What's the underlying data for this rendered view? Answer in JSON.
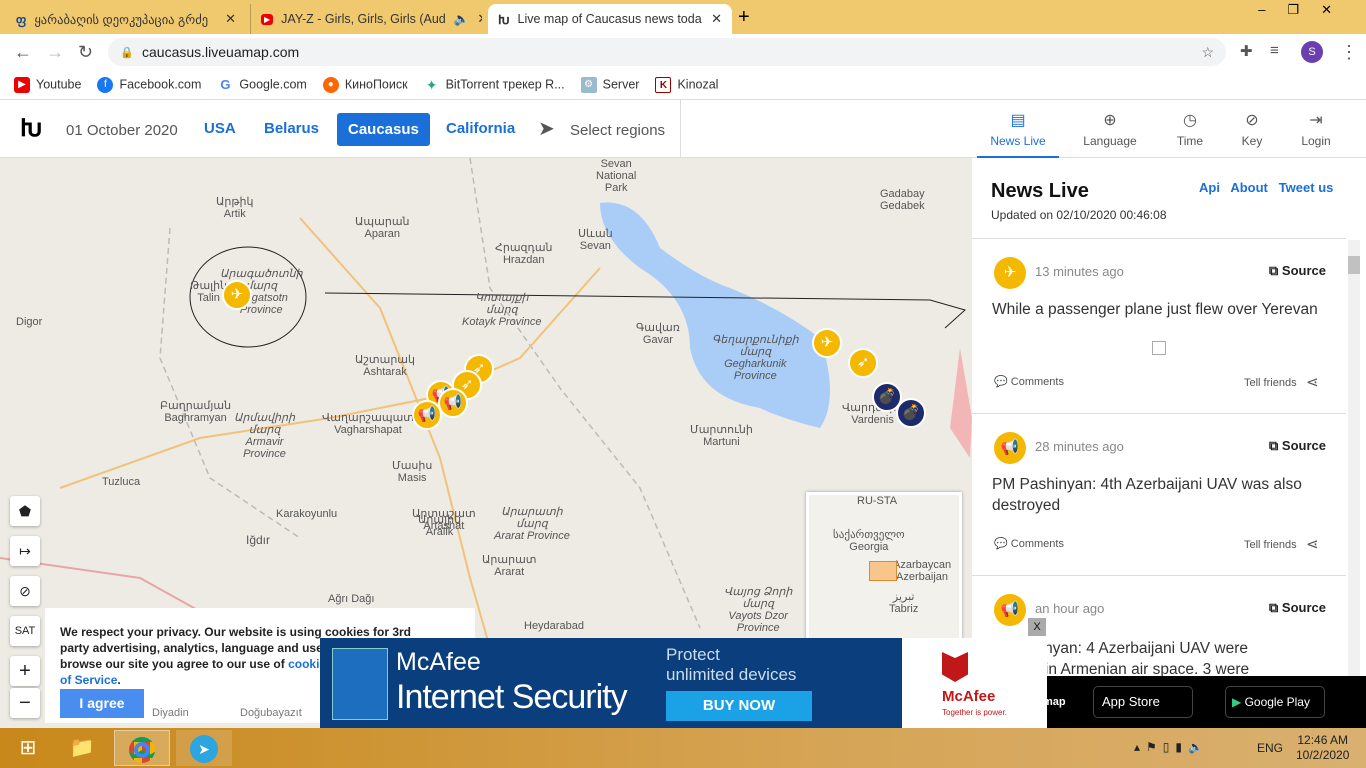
{
  "browser": {
    "tabs": [
      {
        "title": "ყარაბაღის დეოკუპაცია გრძე"
      },
      {
        "title": "JAY-Z - Girls, Girls, Girls (Aud"
      },
      {
        "title": "Live map of Caucasus news toda"
      }
    ],
    "url": "caucasus.liveuamap.com",
    "bookmarks": [
      "Youtube",
      "Facebook.com",
      "Google.com",
      "КиноПоиск",
      "BitTorrent трекер R...",
      "Server",
      "Kinozal"
    ],
    "profile": "S"
  },
  "site": {
    "date": "01 October 2020",
    "regions": [
      "USA",
      "Belarus",
      "Caucasus",
      "California"
    ],
    "active_region": "Caucasus",
    "select_regions": "Select regions",
    "nav": [
      "News Live",
      "Language",
      "Time",
      "Key",
      "Login"
    ]
  },
  "map": {
    "labels": [
      "Արթիկ\nArtik",
      "Ապարան\nAparan",
      "Հրազդան\nHrazdan",
      "Սևան\nSevan",
      "Sevan\nNational\nPark",
      "Gadabay\nGedabek",
      "Արագածոտնի\nմարզ\nAragatsotn\nProvince",
      "Թալին\nTalin",
      "Digor",
      "Կոտայքի\nմարզ\nKotayk Province",
      "Գավառ\nGavar",
      "Գեղարքունիքի\nմարզ\nGegharkunik\nProvince",
      "Աշտարակ\nAshtarak",
      "Բաղրամյան\nBaghramyan",
      "Արմավիրի\nմարզ\nArmavir\nProvince",
      "Վաղարշապատ\nVagharshapat",
      "Մարտունի\nMartuni",
      "Վարդենիս\nVardenis",
      "Մասիս\nMasis",
      "Tuzluca",
      "Karakoyunlu",
      "Արտաշատ\nArtashat",
      "Արարատի\nմարզ\nArarat Province",
      "Iğdır",
      "Արալիկ\nAralik",
      "Արարատ\nArarat",
      "Վայոց Ձորի\nմարզ\nVayots Dzor\nProvince",
      "Heydarabad",
      "Ağrı Dağı",
      "Doğubayazıt",
      "Diyadin"
    ],
    "minimap": [
      "RU-STA",
      "საქართველო\nGeorgia",
      "Azarbaycan\nAzerbaijan",
      "تبریز\nTabriz"
    ],
    "controls": [
      "SAT",
      "+",
      "−"
    ]
  },
  "news": {
    "title": "News Live",
    "links": [
      "Api",
      "About",
      "Tweet us"
    ],
    "updated": "Updated on 02/10/2020 00:46:08",
    "items": [
      {
        "ago": "13 minutes ago",
        "source": "Source",
        "text": "While a passenger plane just flew over Yerevan",
        "comments": "Comments",
        "tell": "Tell friends",
        "icon": "airplane-icon"
      },
      {
        "ago": "28 minutes ago",
        "source": "Source",
        "text": "PM Pashinyan: 4th Azerbaijani UAV was also destroyed",
        "comments": "Comments",
        "tell": "Tell friends",
        "icon": "megaphone-icon"
      },
      {
        "ago": "an hour ago",
        "source": "Source",
        "text": "hinyan: 4 Azerbaijani UAV were\nd in Armenian air space. 3 were",
        "icon": "megaphone-icon"
      }
    ]
  },
  "cookie": {
    "text": "We respect your privacy. Our website is using cookies for 3rd party advertising, analytics, language and user setting",
    "text2": "browse our site you agree to our use of",
    "link1": "cookies",
    "link2": "of Service",
    "agree": "I agree"
  },
  "ad": {
    "brand": "McAfee",
    "product": "Internet Security",
    "tag1": "Protect",
    "tag2": "unlimited devices",
    "cta": "BUY NOW",
    "logo_tag": "Together is power.",
    "close": "X"
  },
  "apps": {
    "partial": "map",
    "appstore": "App Store",
    "googleplay": "Google Play"
  },
  "taskbar": {
    "lang": "ENG",
    "time": "12:46 AM",
    "date": "10/2/2020"
  },
  "colors": {
    "accent": "#1a6fd8",
    "marker": "#f5b800",
    "lake": "#a9cdf7",
    "tabbar": "#f0c96e"
  }
}
